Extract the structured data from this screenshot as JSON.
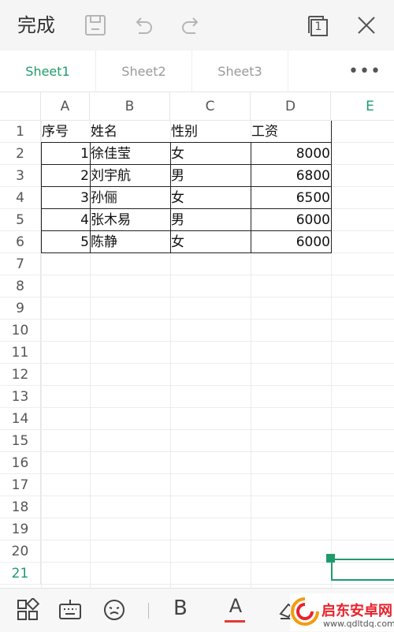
{
  "toolbar": {
    "done_label": "完成",
    "page_count": "1",
    "icons": [
      "save-icon",
      "undo-icon",
      "redo-icon",
      "pages-icon",
      "close-icon"
    ]
  },
  "tabs": {
    "items": [
      "Sheet1",
      "Sheet2",
      "Sheet3"
    ],
    "active": "Sheet1",
    "more_label": "•••"
  },
  "grid": {
    "columns": [
      "A",
      "B",
      "C",
      "D",
      "E"
    ],
    "active_column": "E",
    "rows": [
      "1",
      "2",
      "3",
      "4",
      "5",
      "6",
      "7",
      "8",
      "9",
      "10",
      "11",
      "12",
      "13",
      "14",
      "15",
      "16",
      "17",
      "18",
      "19",
      "20",
      "21"
    ],
    "active_row": "21",
    "cells": [
      [
        "序号",
        "姓名",
        "性别",
        "工资"
      ],
      [
        "1",
        "徐佳莹",
        "女",
        "8000"
      ],
      [
        "2",
        "刘宇航",
        "男",
        "6800"
      ],
      [
        "3",
        "孙俪",
        "女",
        "6500"
      ],
      [
        "4",
        "张木易",
        "男",
        "6000"
      ],
      [
        "5",
        "陈静",
        "女",
        "6000"
      ]
    ]
  },
  "bottom_toolbar": {
    "bold_label": "B",
    "font_color_label": "A",
    "font_color": "#e53935",
    "icons": [
      "layout-grid-icon",
      "keyboard-icon",
      "emoji-icon",
      "clear-format-icon"
    ]
  },
  "watermark": {
    "title": "启东安卓网",
    "url": "www.qdltdq.com"
  },
  "colors": {
    "accent": "#1f9b6c",
    "toolbar_bg": "#f5f5f5"
  }
}
